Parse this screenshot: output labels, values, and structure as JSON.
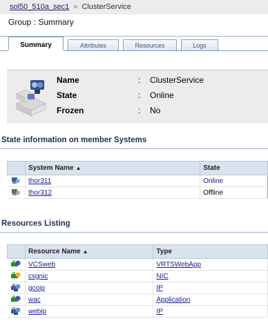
{
  "breadcrumb": {
    "link": "sol50_510a_sec1",
    "separator": "»",
    "current": "ClusterService"
  },
  "group_title": "Group : Summary",
  "tabs": [
    {
      "label": "Summary",
      "active": true
    },
    {
      "label": "Attributes",
      "active": false
    },
    {
      "label": "Resources",
      "active": false
    },
    {
      "label": "Logs",
      "active": false
    }
  ],
  "summary": {
    "props": [
      {
        "label": "Name",
        "colon": ":",
        "value": "ClusterService"
      },
      {
        "label": "State",
        "colon": ":",
        "value": "Online"
      },
      {
        "label": "Frozen",
        "colon": ":",
        "value": "No"
      }
    ]
  },
  "systems": {
    "title": "State information on member Systems",
    "col_name": "System Name",
    "col_state": "State",
    "sort_arrow": "▲",
    "rows": [
      {
        "name": "thor311",
        "state": "Online",
        "icon": "system-online-icon"
      },
      {
        "name": "thor312",
        "state": "Offline",
        "icon": "system-offline-icon"
      }
    ]
  },
  "resources": {
    "title": "Resources Listing",
    "col_name": "Resource Name",
    "col_type": "Type",
    "sort_arrow": "▲",
    "rows": [
      {
        "name": "VCSweb",
        "type": "VRTSWebApp",
        "icon": "resource-online-icon"
      },
      {
        "name": "csgnic",
        "type": "NIC",
        "icon": "resource-online-icon"
      },
      {
        "name": "gcoip",
        "type": "IP",
        "icon": "resource-partial-icon"
      },
      {
        "name": "wac",
        "type": "Application",
        "icon": "resource-online-icon"
      },
      {
        "name": "webip",
        "type": "IP",
        "icon": "resource-partial-icon"
      }
    ]
  }
}
